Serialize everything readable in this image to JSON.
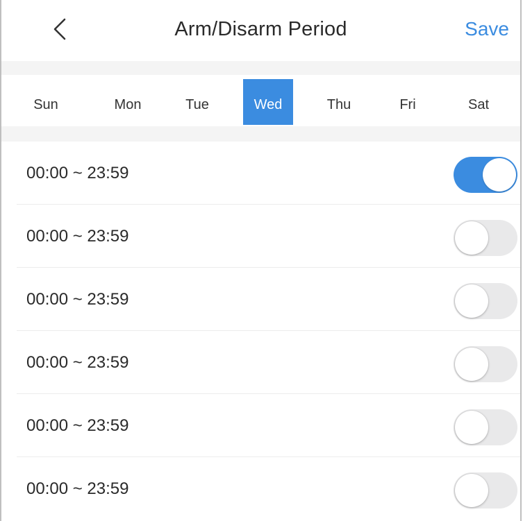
{
  "header": {
    "title": "Arm/Disarm Period",
    "save_label": "Save",
    "back_icon": "chevron-left-icon"
  },
  "days": {
    "items": [
      {
        "label": "Sun",
        "active": false
      },
      {
        "label": "Mon",
        "active": false
      },
      {
        "label": "Tue",
        "active": false
      },
      {
        "label": "Wed",
        "active": true
      },
      {
        "label": "Thu",
        "active": false
      },
      {
        "label": "Fri",
        "active": false
      },
      {
        "label": "Sat",
        "active": false
      }
    ]
  },
  "periods": [
    {
      "label": "00:00 ~ 23:59",
      "enabled": true
    },
    {
      "label": "00:00 ~ 23:59",
      "enabled": false
    },
    {
      "label": "00:00 ~ 23:59",
      "enabled": false
    },
    {
      "label": "00:00 ~ 23:59",
      "enabled": false
    },
    {
      "label": "00:00 ~ 23:59",
      "enabled": false
    },
    {
      "label": "00:00 ~ 23:59",
      "enabled": false
    }
  ],
  "colors": {
    "accent": "#3b8ce0",
    "toggle_off": "#e9e9ea",
    "band": "#f4f4f4"
  }
}
